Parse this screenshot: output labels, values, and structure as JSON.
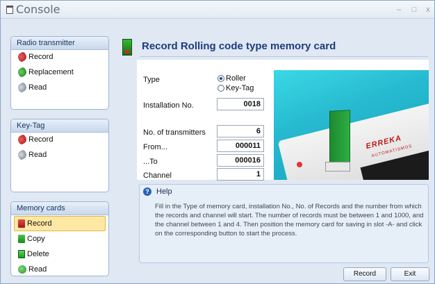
{
  "window": {
    "title": "Console",
    "minimize_glyph": "–",
    "maximize_glyph": "□",
    "close_glyph": "x"
  },
  "sidebar": {
    "radio_transmitter": {
      "header": "Radio transmitter",
      "items": [
        {
          "label": "Record",
          "icon": "transmitter-record-icon"
        },
        {
          "label": "Replacement",
          "icon": "transmitter-replacement-icon"
        },
        {
          "label": "Read",
          "icon": "transmitter-read-icon"
        }
      ]
    },
    "key_tag": {
      "header": "Key-Tag",
      "items": [
        {
          "label": "Record",
          "icon": "keytag-record-icon"
        },
        {
          "label": "Read",
          "icon": "keytag-read-icon"
        }
      ]
    },
    "memory_cards": {
      "header": "Memory cards",
      "items": [
        {
          "label": "Record",
          "icon": "card-record-icon",
          "selected": true
        },
        {
          "label": "Copy",
          "icon": "card-copy-icon"
        },
        {
          "label": "Delete",
          "icon": "card-delete-icon"
        },
        {
          "label": "Read",
          "icon": "card-read-icon"
        }
      ]
    }
  },
  "main": {
    "title": "Record Rolling code type memory card",
    "type_label": "Type",
    "type_options": [
      "Roller",
      "Key-Tag"
    ],
    "type_selected": "Roller",
    "installation_label": "Installation No.",
    "installation_value": "0018",
    "transmitters_label": "No. of transmitters",
    "transmitters_value": "6",
    "from_label": "From...",
    "from_value": "000011",
    "to_label": "...To",
    "to_value": "000016",
    "channel_label": "Channel",
    "channel_value": "1"
  },
  "photo": {
    "brand": "ERREKA",
    "brand_sub": "AUTOMATISMOS"
  },
  "help": {
    "title": "Help",
    "text": "Fill in the Type of memory card, installation No., No. of Records and the number from which the records and channel will start. The number of records must be between 1 and 1000, and the channel between 1 and 4. Then position the memory card for saving in slot -A- and click on the corresponding button to start the process."
  },
  "buttons": {
    "record": "Record",
    "exit": "Exit"
  },
  "colors": {
    "title_blue": "#1d3c7a",
    "selected_bg": "#ffe8a3",
    "window_bg": "#dfe8f3"
  }
}
